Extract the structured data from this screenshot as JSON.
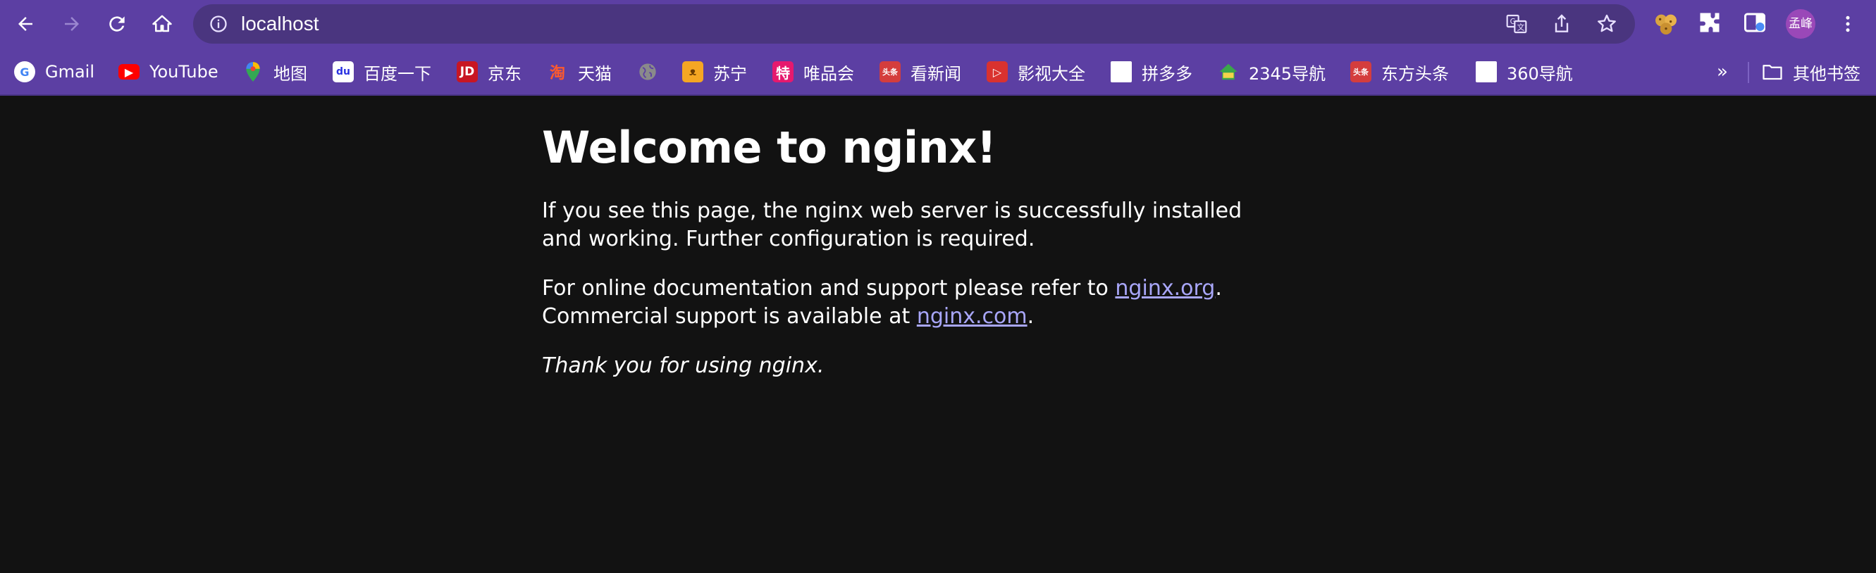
{
  "toolbar": {
    "url": "localhost"
  },
  "profile": {
    "avatar_text": "孟峰"
  },
  "bookmarks": {
    "items": [
      {
        "label": "Gmail",
        "icon": "google-icon",
        "color": "#ffffff"
      },
      {
        "label": "YouTube",
        "icon": "youtube-icon",
        "color": "#ff0000"
      },
      {
        "label": "地图",
        "icon": "maps-icon",
        "color": "#34a853"
      },
      {
        "label": "百度一下",
        "icon": "baidu-icon",
        "color": "#2932e1"
      },
      {
        "label": "京东",
        "icon": "jd-icon",
        "color": "#c81623"
      },
      {
        "label": "天猫",
        "icon": "tmall-icon",
        "color": "#ff0036"
      },
      {
        "label": "",
        "icon": "globe-icon",
        "color": "#8a8a8a"
      },
      {
        "label": "苏宁",
        "icon": "suning-icon",
        "color": "#f5a623"
      },
      {
        "label": "唯品会",
        "icon": "vip-icon",
        "color": "#e6196e"
      },
      {
        "label": "看新闻",
        "icon": "toutiao-icon",
        "color": "#d43d3d"
      },
      {
        "label": "影视大全",
        "icon": "video-icon",
        "color": "#d9322f"
      },
      {
        "label": "拼多多",
        "icon": "blank-icon",
        "color": "#ffffff"
      },
      {
        "label": "2345导航",
        "icon": "house-icon",
        "color": "#3aa64a"
      },
      {
        "label": "东方头条",
        "icon": "toutiao-icon",
        "color": "#d43d3d"
      },
      {
        "label": "360导航",
        "icon": "blank-icon",
        "color": "#ffffff"
      }
    ],
    "more": "»",
    "other_folder": "其他书签"
  },
  "page": {
    "title": "Welcome to nginx!",
    "para1": "If you see this page, the nginx web server is successfully installed and working. Further configuration is required.",
    "para2_prefix": "For online documentation and support please refer to ",
    "para2_link": "nginx.org",
    "para2_mid": ".",
    "para2_line2_prefix": "Commercial support is available at ",
    "para2_link2": "nginx.com",
    "para2_suffix": ".",
    "thanks": "Thank you for using nginx."
  },
  "colors": {
    "chrome_bg": "#5c3fa3",
    "omnibox_bg": "#4a357f",
    "page_bg": "#121212",
    "link": "#a8a6f8"
  }
}
